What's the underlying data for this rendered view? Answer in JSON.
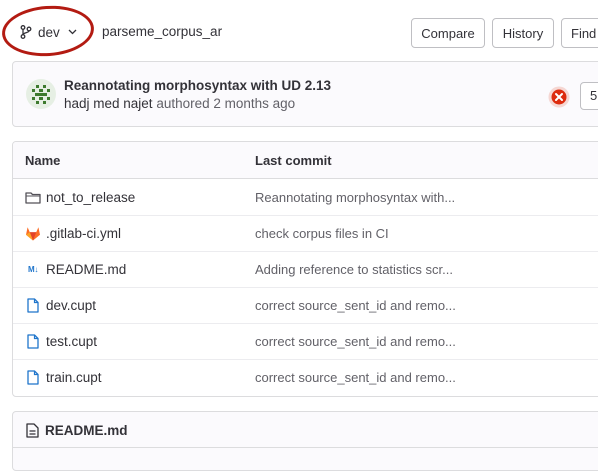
{
  "branch": {
    "label": "dev"
  },
  "repo": {
    "path": "parseme_corpus_ar"
  },
  "buttons": {
    "compare": "Compare",
    "history": "History",
    "find": "Find"
  },
  "last_commit": {
    "title": "Reannotating morphosyntax with UD 2.13",
    "author": "hadj med najet",
    "action": "authored",
    "time": "2 months ago",
    "sha_fragment": "5"
  },
  "table": {
    "headers": {
      "name": "Name",
      "last_commit": "Last commit"
    },
    "rows": [
      {
        "name": "not_to_release",
        "commit": "Reannotating morphosyntax with...",
        "icon": "folder-icon"
      },
      {
        "name": ".gitlab-ci.yml",
        "commit": "check corpus files in CI",
        "icon": "gitlab-icon"
      },
      {
        "name": "README.md",
        "commit": "Adding reference to statistics scr...",
        "icon": "markdown-icon"
      },
      {
        "name": "dev.cupt",
        "commit": "correct source_sent_id and remo...",
        "icon": "file-icon"
      },
      {
        "name": "test.cupt",
        "commit": "correct source_sent_id and remo...",
        "icon": "file-icon"
      },
      {
        "name": "train.cupt",
        "commit": "correct source_sent_id and remo...",
        "icon": "file-icon"
      }
    ]
  },
  "readme": {
    "title": "README.md"
  },
  "icons": {
    "markdown_label": "M↓"
  },
  "colors": {
    "annotation_circle": "#b31b12",
    "failed_status": "#dd2b0e",
    "file_icon": "#1f75cb",
    "gitlab_orange": "#fc6d26"
  }
}
